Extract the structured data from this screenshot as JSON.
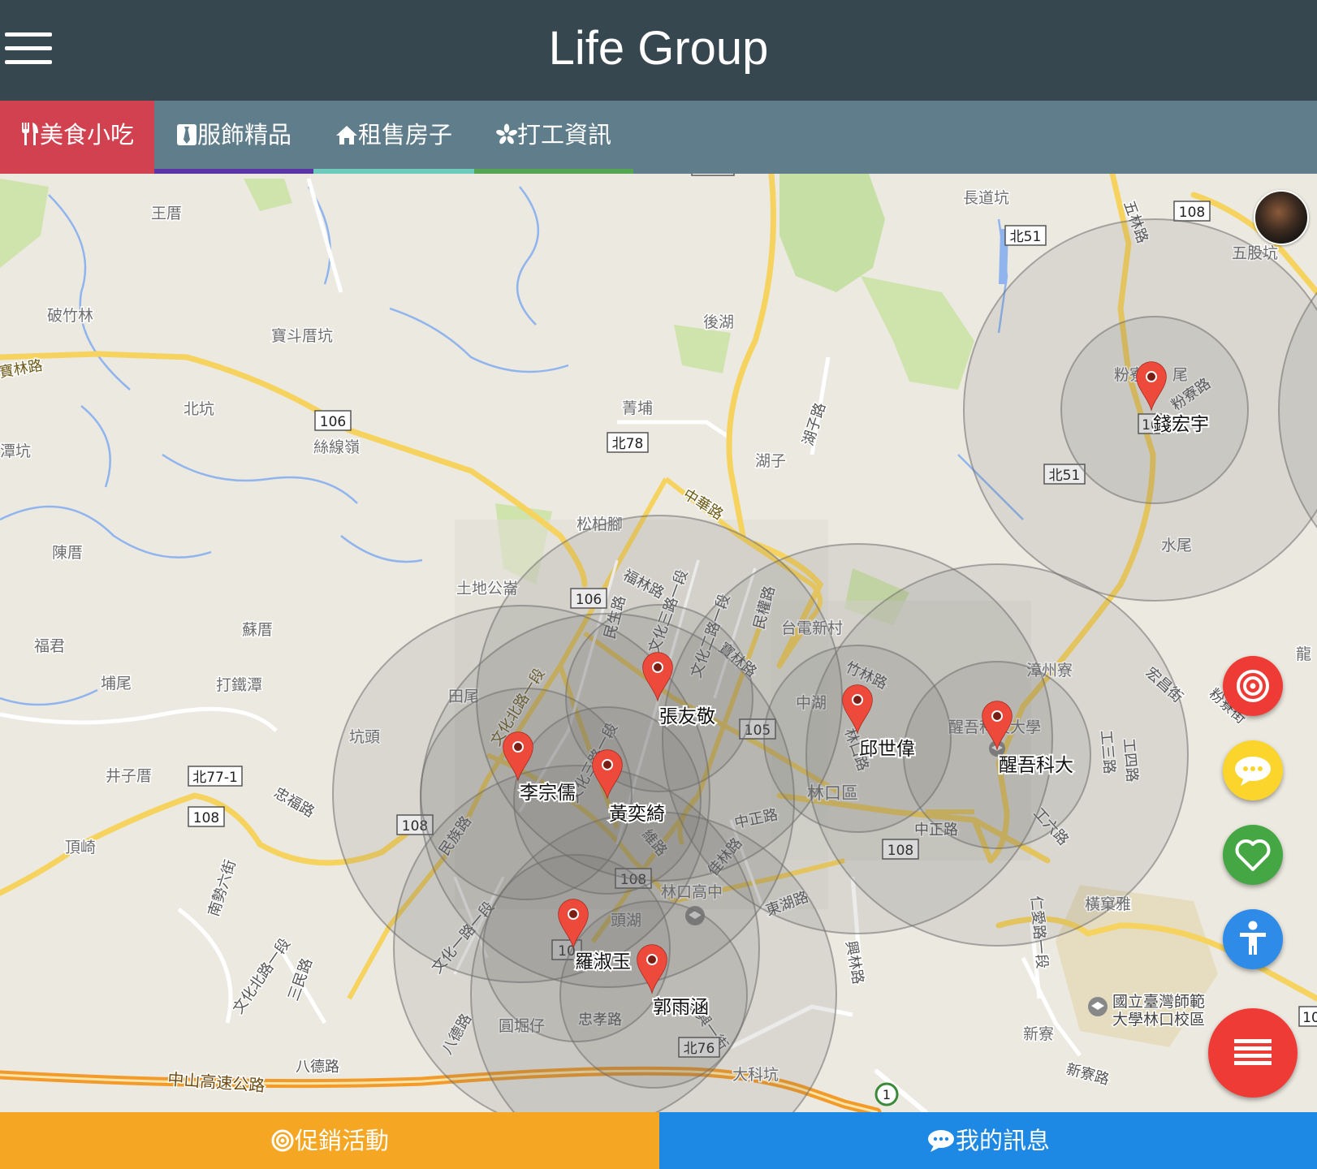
{
  "header": {
    "title": "Life Group"
  },
  "tabs": [
    {
      "label": "美食小吃",
      "icon": "fork-knife-icon",
      "underline": "#d2414f"
    },
    {
      "label": "服飾精品",
      "icon": "tie-icon",
      "underline": "#5b35a8"
    },
    {
      "label": "租售房子",
      "icon": "house-icon",
      "underline": "#6ccabc"
    },
    {
      "label": "打工資訊",
      "icon": "asterisk-icon",
      "underline": "#53a64f"
    }
  ],
  "map": {
    "place_labels": [
      "王厝",
      "破竹林",
      "寶斗厝坑",
      "後湖",
      "長道坑",
      "五股坑",
      "北坑",
      "菁埔",
      "湖子",
      "絲線嶺",
      "陳厝",
      "松柏腳",
      "土地公崙",
      "蘇厝",
      "福君",
      "埔尾",
      "打鐵潭",
      "田尾",
      "坑頭",
      "井子厝",
      "頂崎",
      "台電新村",
      "中湖",
      "漳州寮",
      "醒吾科技大學",
      "林口區",
      "林口高中",
      "頭湖",
      "圓堀仔",
      "大科坑",
      "新寮",
      "橫窠雅",
      "水尾",
      "國立臺灣師範",
      "大學林口校區",
      "龍",
      "粉寮",
      "尾",
      "潭坑"
    ],
    "road_labels": [
      "寶林路",
      "中華路",
      "福林路",
      "文化三路一段",
      "文化二路一段",
      "民生路",
      "民權路",
      "寶林路",
      "竹林路",
      "林口路",
      "文化北路一段",
      "文化三路一段",
      "民族路",
      "中正路",
      "佳林路",
      "東湖路",
      "中正路",
      "仁愛路一段",
      "興林路",
      "工六路",
      "工三路",
      "工四路",
      "宏昌街",
      "粉寮路",
      "粉寮街",
      "五林路",
      "湖子路",
      "忠福路",
      "南勢六街",
      "文化北路一段",
      "三民路",
      "八德路",
      "中山高速公路",
      "忠孝路",
      "八德路",
      "文化一路一段",
      "新寮路",
      "復興一街",
      "維路"
    ],
    "shields": [
      "106",
      "北78",
      "106",
      "105",
      "北77-1",
      "108",
      "108",
      "108",
      "108",
      "北51",
      "北51",
      "108",
      "10",
      "北76",
      "1",
      "10",
      "10",
      "108"
    ],
    "markers": [
      "張友敬",
      "李宗儒",
      "黃奕綺",
      "邱世偉",
      "醒吾科大",
      "羅淑玉",
      "郭雨涵",
      "錢宏宇"
    ]
  },
  "fabs": [
    {
      "name": "target-icon",
      "color": "#ef3b36"
    },
    {
      "name": "chat-icon",
      "color": "#fbd52c"
    },
    {
      "name": "heart-icon",
      "color": "#44a744"
    },
    {
      "name": "accessibility-icon",
      "color": "#2f8be8"
    },
    {
      "name": "list-icon",
      "color": "#ef3b36"
    }
  ],
  "bottom_bar": [
    {
      "label": "促銷活動",
      "icon": "target-icon",
      "color": "#f5a623"
    },
    {
      "label": "我的訊息",
      "icon": "chat-icon",
      "color": "#1e88e5"
    }
  ]
}
